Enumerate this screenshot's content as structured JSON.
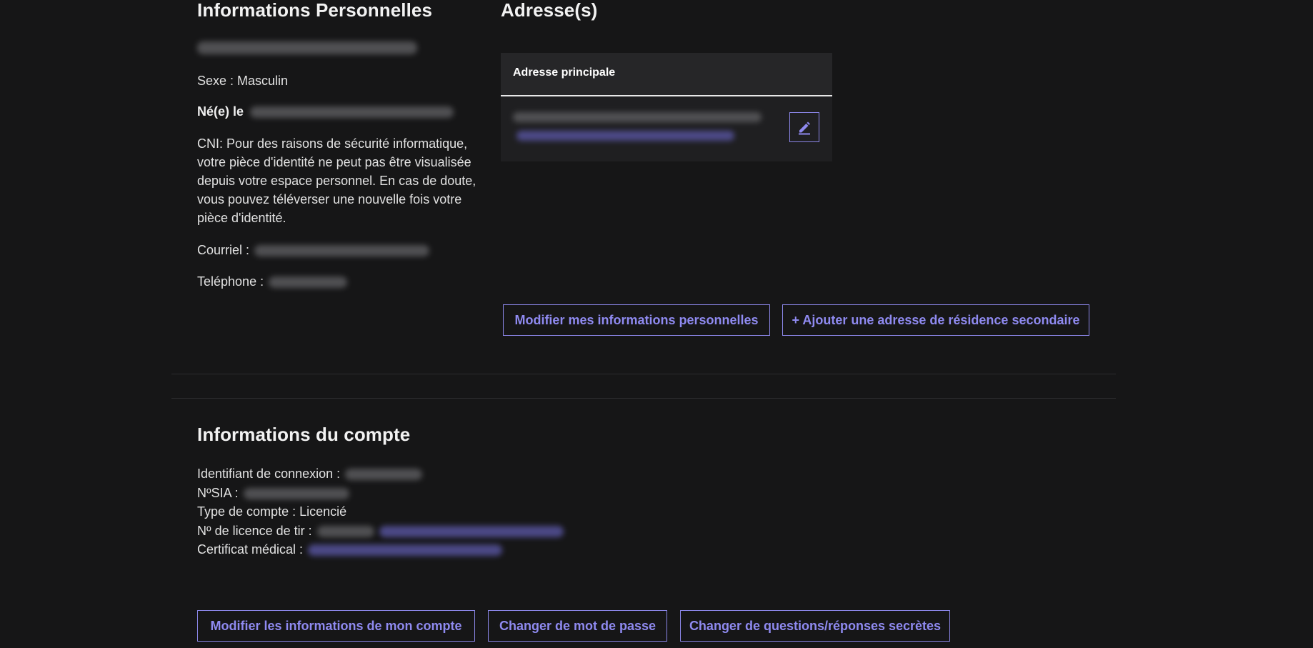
{
  "personal": {
    "title": "Informations Personnelles",
    "sexe": "Sexe : Masculin",
    "ne_label": "Né(e) le",
    "cni_text": "CNI: Pour des raisons de sécurité informatique, votre pièce d'identité ne peut pas être visualisée depuis votre espace personnel. En cas de doute, vous pouvez téléverser une nouvelle fois votre pièce d'identité.",
    "courriel_label": "Courriel :",
    "telephone_label": "Teléphone :"
  },
  "address": {
    "title": "Adresse(s)",
    "card_header": "Adresse principale"
  },
  "buttons": {
    "edit_personal": "Modifier mes informations personnelles",
    "add_address": "+ Ajouter une adresse de résidence secondaire",
    "edit_account": "Modifier les informations de mon compte",
    "change_password": "Changer de mot de passe",
    "change_questions": "Changer de questions/réponses secrètes"
  },
  "account": {
    "title": "Informations du compte",
    "login_label": "Identifiant de connexion :",
    "sia_label": "NºSIA :",
    "type": "Type de compte : Licencié",
    "licence_label": "Nº de licence de tir :",
    "certificat_label": "Certificat médical :"
  },
  "colors": {
    "background": "#161617",
    "accent": "#8b86e8",
    "text": "#e6e6e6"
  }
}
